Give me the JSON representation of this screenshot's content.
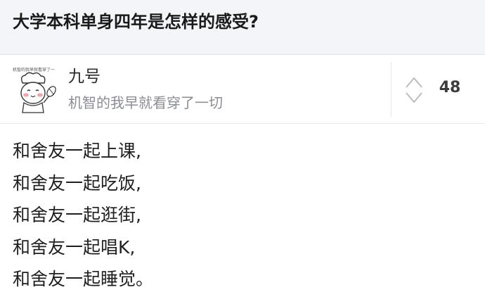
{
  "question": {
    "title": "大学本科单身四年是怎样的感受?"
  },
  "author": {
    "name": "九号",
    "bio": "机智的我早就看穿了一切",
    "avatar_caption": "机智的我早就看穿了一",
    "avatar_icon": "cartoon-chef-avatar"
  },
  "vote": {
    "count": "48",
    "icon": "vote-up-down-arrows-icon"
  },
  "answer": {
    "lines": [
      "和舍友一起上课,",
      "和舍友一起吃饭,",
      "和舍友一起逛街,",
      "和舍友一起唱K,",
      "和舍友一起睡觉。"
    ]
  },
  "colors": {
    "header_bg": "#f4f5f8",
    "text_primary": "#1a1a1a",
    "text_secondary": "#8a8d94",
    "divider": "#e6e7eb"
  }
}
